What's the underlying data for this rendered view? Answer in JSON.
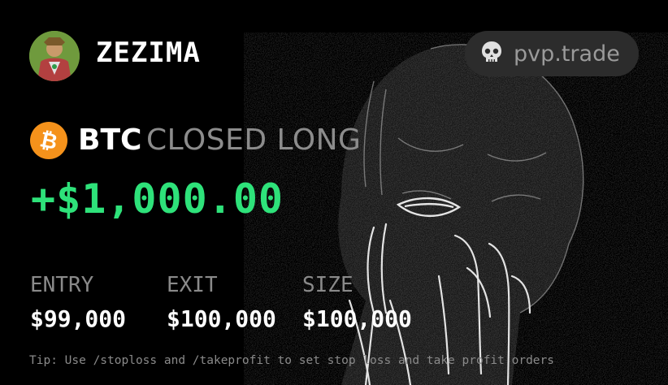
{
  "user": {
    "name": "ZEZIMA"
  },
  "brand": {
    "label": "pvp.trade",
    "icon": "skull-icon"
  },
  "trade": {
    "ticker": "BTC",
    "coin_icon": "bitcoin-icon",
    "status": "CLOSED LONG",
    "pnl": "+$1,000.00"
  },
  "stats": {
    "entry_label": "ENTRY",
    "entry_value": "$99,000",
    "exit_label": "EXIT",
    "exit_value": "$100,000",
    "size_label": "SIZE",
    "size_value": "$100,000"
  },
  "tip": "Tip: Use /stoploss and /takeprofit to set stop loss and take profit orders",
  "colors": {
    "background": "#000000",
    "profit": "#2ee27a",
    "bitcoin": "#f5921b",
    "muted": "#8a8a8a",
    "pill": "#2c2c2c"
  }
}
